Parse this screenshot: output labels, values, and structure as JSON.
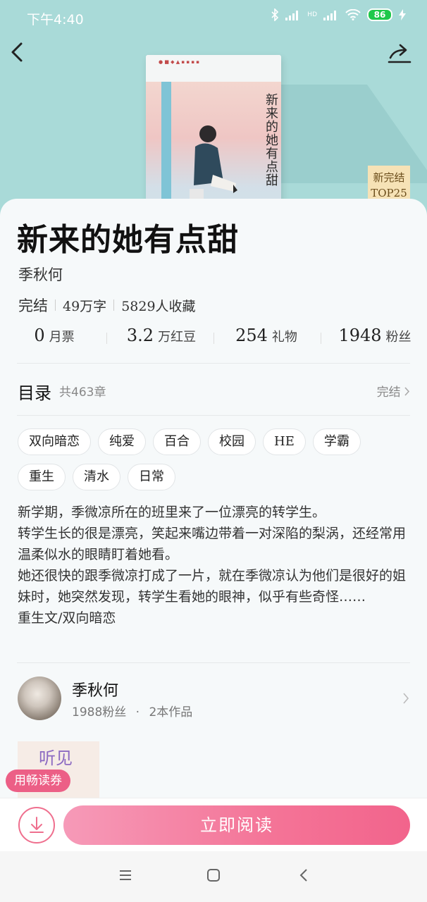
{
  "status_bar": {
    "time": "下午4:40",
    "network": "HD",
    "battery": "86"
  },
  "book": {
    "title": "新来的她有点甜",
    "cover_title": "新来的她有点甜",
    "author": "季秋何",
    "status": "完结",
    "word_count": "49万字",
    "favorites": "5829人收藏",
    "badge_line1": "新完结",
    "badge_line2": "TOP25"
  },
  "stats": [
    {
      "value": "0",
      "unit": "月票"
    },
    {
      "value": "3.2",
      "unit": "万红豆"
    },
    {
      "value": "254",
      "unit": "礼物"
    },
    {
      "value": "1948",
      "unit": "粉丝"
    }
  ],
  "toc": {
    "label": "目录",
    "count": "共463章",
    "status": "完结"
  },
  "tags": [
    "双向暗恋",
    "纯爱",
    "百合",
    "校园",
    "HE",
    "学霸",
    "重生",
    "清水",
    "日常"
  ],
  "description": [
    "新学期，季微凉所在的班里来了一位漂亮的转学生。",
    "转学生长的很是漂亮，笑起来嘴边带着一对深陷的梨涡，还经常用温柔似水的眼睛盯着她看。",
    "她还很快的跟季微凉打成了一片，就在季微凉认为他们是很好的姐妹时，她突然发现，转学生看她的眼神，似乎有些奇怪……",
    "重生文/双向暗恋"
  ],
  "author_card": {
    "name": "季秋何",
    "fans": "1988粉丝",
    "dot": "·",
    "works": "2本作品"
  },
  "related": {
    "cover_text": "听见"
  },
  "voucher": "用畅读券",
  "read_button": "立即阅读",
  "colors": {
    "hero_bg": "#a9dad8",
    "accent": "#f2648c",
    "badge_bg": "#f6e2b6"
  }
}
